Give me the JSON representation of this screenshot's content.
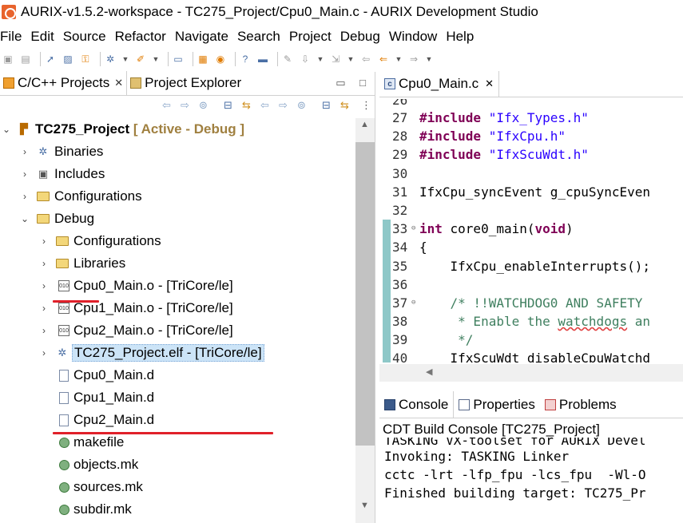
{
  "window": {
    "title": "AURIX-v1.5.2-workspace - TC275_Project/Cpu0_Main.c - AURIX Development Studio"
  },
  "menu": [
    "File",
    "Edit",
    "Source",
    "Refactor",
    "Navigate",
    "Search",
    "Project",
    "Debug",
    "Window",
    "Help"
  ],
  "left_tabs": [
    {
      "label": "C/C++ Projects",
      "close": "✕"
    },
    {
      "label": "Project Explorer"
    }
  ],
  "tree": {
    "project": {
      "name": "TC275_Project",
      "decoration": "[ Active - Debug ]"
    },
    "binaries": "Binaries",
    "includes": "Includes",
    "configurations": "Configurations",
    "debug": "Debug",
    "debug_children": {
      "configurations": "Configurations",
      "libraries": "Libraries",
      "cpu0_obj": "Cpu0_Main.o - [TriCore/le]",
      "cpu1_obj": "Cpu1_Main.o - [TriCore/le]",
      "cpu2_obj": "Cpu2_Main.o - [TriCore/le]",
      "elf": "TC275_Project.elf - [TriCore/le]",
      "cpu0_d": "Cpu0_Main.d",
      "cpu1_d": "Cpu1_Main.d",
      "cpu2_d": "Cpu2_Main.d",
      "makefile": "makefile",
      "objects_mk": "objects.mk",
      "sources_mk": "sources.mk",
      "subdir_mk": "subdir.mk"
    }
  },
  "editor": {
    "tab": "Cpu0_Main.c",
    "lines": [
      {
        "n": "26",
        "segs": []
      },
      {
        "n": "27",
        "segs": [
          {
            "t": "#include ",
            "c": "kw"
          },
          {
            "t": "\"Ifx_Types.h\"",
            "c": "str"
          }
        ]
      },
      {
        "n": "28",
        "segs": [
          {
            "t": "#include ",
            "c": "kw"
          },
          {
            "t": "\"IfxCpu.h\"",
            "c": "str"
          }
        ]
      },
      {
        "n": "29",
        "segs": [
          {
            "t": "#include ",
            "c": "kw"
          },
          {
            "t": "\"IfxScuWdt.h\"",
            "c": "str"
          }
        ]
      },
      {
        "n": "30",
        "segs": []
      },
      {
        "n": "31",
        "segs": [
          {
            "t": "IfxCpu_syncEvent g_cpuSyncEven",
            "c": ""
          }
        ]
      },
      {
        "n": "32",
        "segs": []
      },
      {
        "n": "33",
        "fold": true,
        "segs": [
          {
            "t": "int ",
            "c": "kw"
          },
          {
            "t": "core0_main(",
            "c": ""
          },
          {
            "t": "void",
            "c": "kw"
          },
          {
            "t": ")",
            "c": ""
          }
        ]
      },
      {
        "n": "34",
        "segs": [
          {
            "t": "{",
            "c": ""
          }
        ]
      },
      {
        "n": "35",
        "segs": [
          {
            "t": "    IfxCpu_enableInterrupts();",
            "c": ""
          }
        ]
      },
      {
        "n": "36",
        "segs": []
      },
      {
        "n": "37",
        "fold": true,
        "segs": [
          {
            "t": "    /* !!WATCHDOG0 AND SAFETY",
            "c": "cmt"
          }
        ]
      },
      {
        "n": "38",
        "segs": [
          {
            "t": "     * Enable the ",
            "c": "cmt"
          },
          {
            "t": "watchdogs",
            "c": "cmt squiggle"
          },
          {
            "t": " an",
            "c": "cmt"
          }
        ]
      },
      {
        "n": "39",
        "segs": [
          {
            "t": "     */",
            "c": "cmt"
          }
        ]
      },
      {
        "n": "40",
        "segs": [
          {
            "t": "    IfxScuWdt_disableCpuWatchd",
            "c": ""
          }
        ]
      }
    ]
  },
  "console": {
    "tabs": [
      "Console",
      "Properties",
      "Problems"
    ],
    "title": "CDT Build Console [TC275_Project]",
    "lines": [
      "TASKING VX-toolset for AURIX Devel",
      "Invoking: TASKING Linker",
      "cctc -lrt -lfp_fpu -lcs_fpu  -Wl-O",
      "Finished building target: TC275_Pr"
    ]
  }
}
